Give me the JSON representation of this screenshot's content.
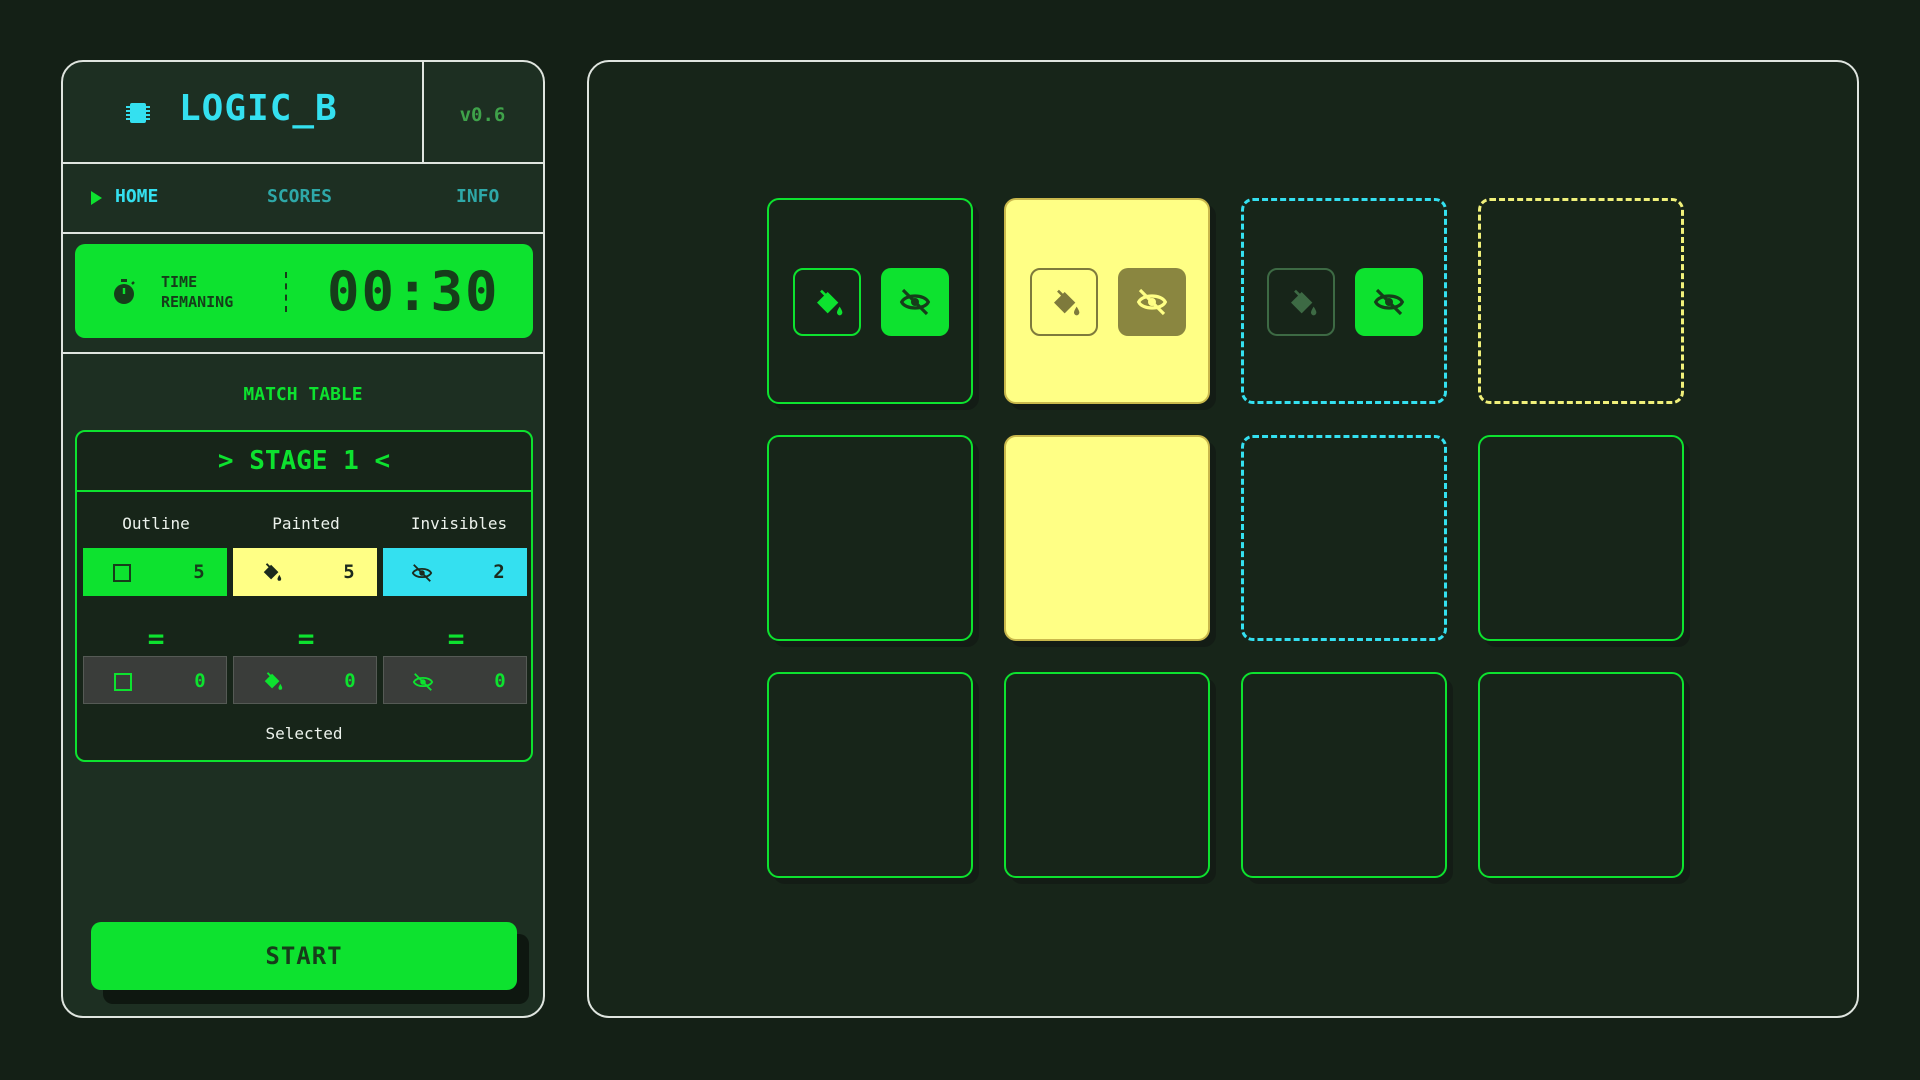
{
  "app": {
    "title": "LOGIC_B",
    "version": "v0.6",
    "chip_icon": "chip-icon"
  },
  "nav": {
    "items": [
      {
        "label": "HOME",
        "active": true
      },
      {
        "label": "SCORES",
        "active": false
      },
      {
        "label": "INFO",
        "active": false
      }
    ]
  },
  "timer": {
    "label": "TIME REMANING",
    "value": "00:30",
    "icon": "stopwatch-icon"
  },
  "match_table": {
    "title": "MATCH TABLE",
    "stage": "> STAGE 1 <",
    "columns": [
      "Outline",
      "Painted",
      "Invisibles"
    ],
    "targets": [
      {
        "icon": "square-outline-icon",
        "value": "5",
        "color": "#0de22f"
      },
      {
        "icon": "paint-bucket-icon",
        "value": "5",
        "color": "#ffff85"
      },
      {
        "icon": "eye-off-icon",
        "value": "2",
        "color": "#34e0f0"
      }
    ],
    "equals": [
      "=",
      "=",
      "="
    ],
    "selected": [
      {
        "icon": "square-outline-icon",
        "value": "0"
      },
      {
        "icon": "paint-bucket-icon",
        "value": "0"
      },
      {
        "icon": "eye-off-icon",
        "value": "0"
      }
    ],
    "selected_label": "Selected"
  },
  "start_button": {
    "label": "START"
  },
  "colors": {
    "green": "#0de22f",
    "yellow": "#ffff85",
    "cyan": "#34e0f0",
    "background": "#142016"
  },
  "board": {
    "rows": 3,
    "cols": 4,
    "tiles": [
      [
        "outline",
        "painted",
        "invisible",
        "invisible-painted"
      ],
      [
        "outline",
        "painted",
        "invisible",
        "outline"
      ],
      [
        "outline",
        "outline",
        "outline",
        "outline"
      ]
    ]
  }
}
